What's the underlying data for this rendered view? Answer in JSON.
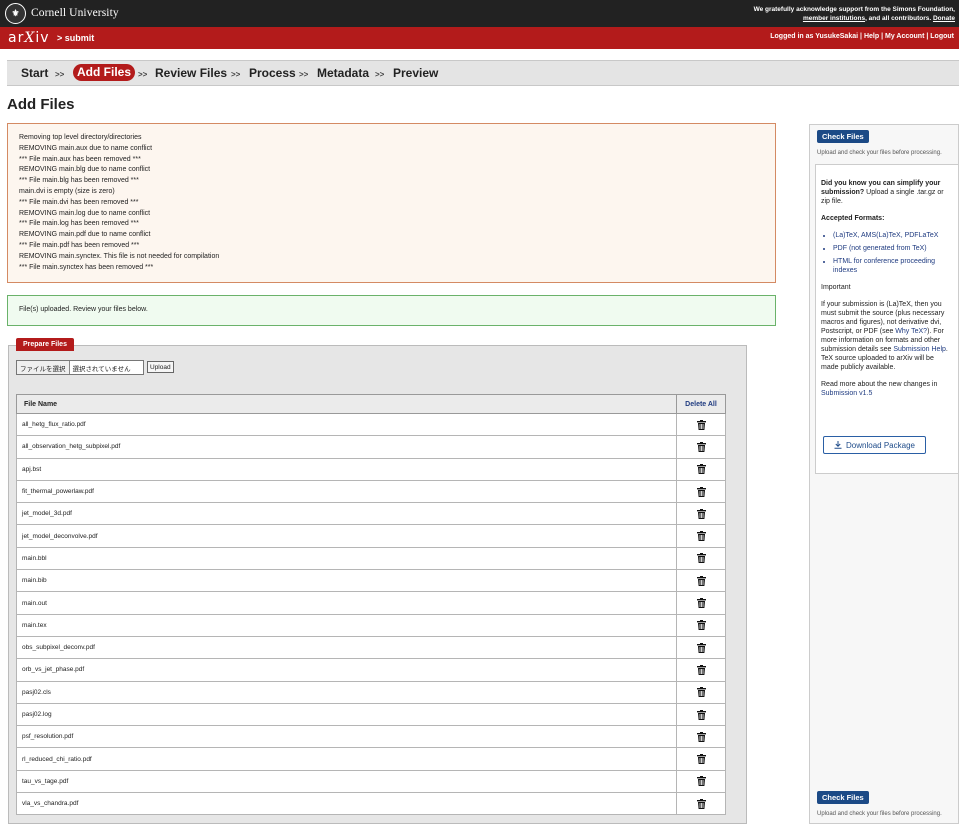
{
  "topbar": {
    "university": "Cornell University",
    "ack_line1": "We gratefully acknowledge support from the Simons Foundation,",
    "ack_link": "member institutions",
    "ack_mid": ", and all contributors.",
    "ack_donate": "Donate"
  },
  "header": {
    "logo": "arXiv",
    "section": "> submit",
    "logged_in_prefix": "Logged in as",
    "username": "YusukeSakai",
    "help": "Help",
    "my_account": "My Account",
    "logout": "Logout",
    "sep": "|"
  },
  "steps": {
    "items": [
      "Start",
      "Add Files",
      "Review Files",
      "Process",
      "Metadata",
      "Preview"
    ],
    "separator": ">>",
    "active_index": 1
  },
  "page_title": "Add Files",
  "log_lines": [
    "Removing top level directory/directories",
    "REMOVING main.aux due to name conflict",
    "*** File main.aux has been removed ***",
    "REMOVING main.blg due to name conflict",
    "*** File main.blg has been removed ***",
    "main.dvi is empty (size is zero)",
    "*** File main.dvi has been removed ***",
    "REMOVING main.log due to name conflict",
    "*** File main.log has been removed ***",
    "REMOVING main.pdf due to name conflict",
    "*** File main.pdf has been removed ***",
    "REMOVING main.synctex. This file is not needed for compilation",
    "*** File main.synctex has been removed ***"
  ],
  "success_message": "File(s) uploaded. Review your files below.",
  "prepare": {
    "tab_label": "Prepare Files",
    "choose_file": "ファイルを選択",
    "no_file": "選択されていません",
    "upload_button": "Upload"
  },
  "table": {
    "col_name": "File Name",
    "col_delete": "Delete All",
    "files": [
      "all_hetg_flux_ratio.pdf",
      "all_observation_hetg_subpixel.pdf",
      "apj.bst",
      "fit_thermal_powerlaw.pdf",
      "jet_model_3d.pdf",
      "jet_model_deconvolve.pdf",
      "main.bbl",
      "main.bib",
      "main.out",
      "main.tex",
      "obs_subpixel_deconv.pdf",
      "orb_vs_jet_phase.pdf",
      "pasj02.cls",
      "pasj02.log",
      "psf_resolution.pdf",
      "rl_reduced_chi_ratio.pdf",
      "tau_vs_tage.pdf",
      "vla_vs_chandra.pdf"
    ]
  },
  "sidebar": {
    "check_files": "Check Files",
    "check_hint": "Upload and check your files before processing.",
    "simplify_bold": "Did you know you can simplify your submission?",
    "simplify_rest": " Upload a single .tar.gz or zip file.",
    "formats_heading": "Accepted Formats:",
    "formats": [
      "(La)TeX, AMS(La)TeX, PDFLaTeX",
      "PDF (not generated from TeX)",
      "HTML for conference proceeding indexes"
    ],
    "important": "Important",
    "important_text1": "If your submission is (La)TeX, then you must submit the source (plus necessary macros and figures), not derivative dvi, Postscript, or PDF (see ",
    "why_tex": "Why TeX?",
    "important_text2": "). For more information on formats and other submission details see ",
    "submission_help": "Submission Help",
    "important_text3": ". TeX source uploaded to arXiv will be made publicly available.",
    "read_more": "Read more about the new changes in ",
    "submission_v15": "Submission v1.5",
    "download_package": "Download Package"
  }
}
